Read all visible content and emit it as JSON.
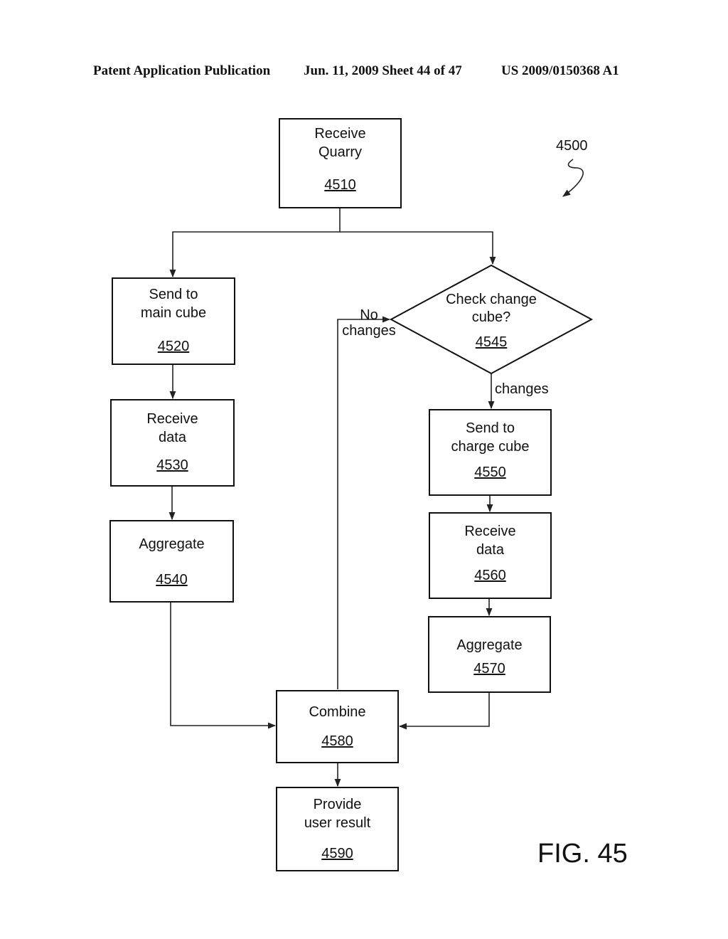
{
  "header": {
    "publication": "Patent Application Publication",
    "date_sheet": "Jun. 11, 2009  Sheet 44 of 47",
    "patent_number": "US 2009/0150368 A1"
  },
  "figure": {
    "label": "FIG. 45",
    "reference": "4500"
  },
  "nodes": [
    {
      "id": "4510",
      "shape": "rect",
      "lines": [
        "Receive",
        "Quarry"
      ],
      "ref": "4510"
    },
    {
      "id": "4520",
      "shape": "rect",
      "lines": [
        "Send to",
        "main cube"
      ],
      "ref": "4520"
    },
    {
      "id": "4530",
      "shape": "rect",
      "lines": [
        "Receive",
        "data"
      ],
      "ref": "4530"
    },
    {
      "id": "4540",
      "shape": "rect",
      "lines": [
        "Aggregate"
      ],
      "ref": "4540"
    },
    {
      "id": "4545",
      "shape": "diamond",
      "lines": [
        "Check change",
        "cube?"
      ],
      "ref": "4545"
    },
    {
      "id": "4550",
      "shape": "rect",
      "lines": [
        "Send to",
        "charge cube"
      ],
      "ref": "4550"
    },
    {
      "id": "4560",
      "shape": "rect",
      "lines": [
        "Receive",
        "data"
      ],
      "ref": "4560"
    },
    {
      "id": "4570",
      "shape": "rect",
      "lines": [
        "Aggregate"
      ],
      "ref": "4570"
    },
    {
      "id": "4580",
      "shape": "rect",
      "lines": [
        "Combine"
      ],
      "ref": "4580"
    },
    {
      "id": "4590",
      "shape": "rect",
      "lines": [
        "Provide",
        "user result"
      ],
      "ref": "4590"
    }
  ],
  "edges": [
    {
      "from": "4510",
      "to": "4520",
      "label": ""
    },
    {
      "from": "4510",
      "to": "4545",
      "label": ""
    },
    {
      "from": "4520",
      "to": "4530",
      "label": ""
    },
    {
      "from": "4530",
      "to": "4540",
      "label": ""
    },
    {
      "from": "4540",
      "to": "4580",
      "label": ""
    },
    {
      "from": "4545",
      "to": "4550",
      "label": "changes"
    },
    {
      "from": "4580",
      "to": "4545",
      "label": "No changes",
      "label_lines": [
        "No",
        "changes"
      ]
    },
    {
      "from": "4550",
      "to": "4560",
      "label": ""
    },
    {
      "from": "4560",
      "to": "4570",
      "label": ""
    },
    {
      "from": "4570",
      "to": "4580",
      "label": ""
    },
    {
      "from": "4580",
      "to": "4590",
      "label": ""
    }
  ]
}
